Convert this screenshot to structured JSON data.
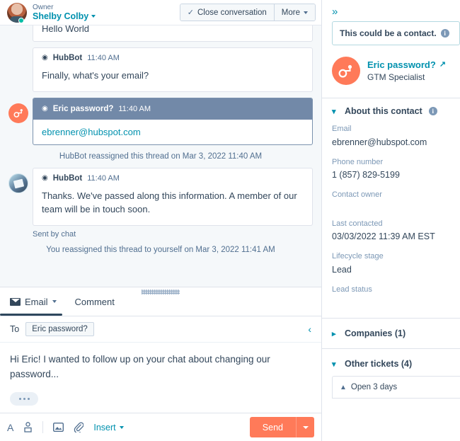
{
  "header": {
    "owner_label": "Owner",
    "owner_name": "Shelby Colby",
    "close_conversation": "Close conversation",
    "more": "More",
    "check_icon": "✓",
    "avatar_icon": "user-avatar"
  },
  "thread": {
    "messages": [
      {
        "kind": "plain",
        "body": "Hello World"
      },
      {
        "kind": "card",
        "sender": "HubBot",
        "time": "11:40 AM",
        "body": "Finally, what's your email?"
      },
      {
        "kind": "selected",
        "sender": "Eric password?",
        "time": "11:40 AM",
        "body": "ebrenner@hubspot.com"
      },
      {
        "kind": "system",
        "body": "HubBot reassigned this thread on Mar 3, 2022 11:40 AM"
      },
      {
        "kind": "card-avatar",
        "sender": "HubBot",
        "time": "11:40 AM",
        "body": "Thanks. We've passed along this information. A member of our team will be in touch soon.",
        "footer": "Sent by chat"
      },
      {
        "kind": "system",
        "body": "You reassigned this thread to yourself on Mar 3, 2022 11:41 AM"
      }
    ]
  },
  "composer": {
    "tabs": [
      {
        "label": "Email",
        "active": true
      },
      {
        "label": "Comment",
        "active": false
      }
    ],
    "to_label": "To",
    "to_token": "Eric password?",
    "collapse_icon": "‹",
    "body_text": "Hi Eric! I wanted to follow up on your chat about changing our password...",
    "typing_indicator": "•••",
    "toolbar": {
      "font_icon": "A",
      "personalize_icon": "personalization-token",
      "image_icon": "image",
      "attachment_icon": "paperclip",
      "insert_label": "Insert"
    },
    "send_label": "Send"
  },
  "sidebar": {
    "expand_icon": "»",
    "contact_hint": "This could be a contact.",
    "contact": {
      "name": "Eric password?",
      "role": "GTM Specialist",
      "external_icon": "↗"
    },
    "about_section": {
      "title": "About this contact",
      "properties": [
        {
          "label": "Email",
          "value": "ebrenner@hubspot.com"
        },
        {
          "label": "Phone number",
          "value": "1 (857) 829-5199"
        },
        {
          "label": "Contact owner",
          "value": ""
        },
        {
          "label": "Last contacted",
          "value": "03/03/2022 11:39 AM EST"
        },
        {
          "label": "Lifecycle stage",
          "value": "Lead"
        },
        {
          "label": "Lead status",
          "value": ""
        }
      ]
    },
    "companies_section": {
      "title": "Companies (1)"
    },
    "tickets_section": {
      "title": "Other tickets (4)",
      "first_ticket": "Open 3 days"
    }
  },
  "colors": {
    "brand_orange": "#ff7a59",
    "teal_link": "#0091ae",
    "dark_navy": "#33475b",
    "selected_row": "#7289a8",
    "panel_bg": "#f5f8fa"
  }
}
